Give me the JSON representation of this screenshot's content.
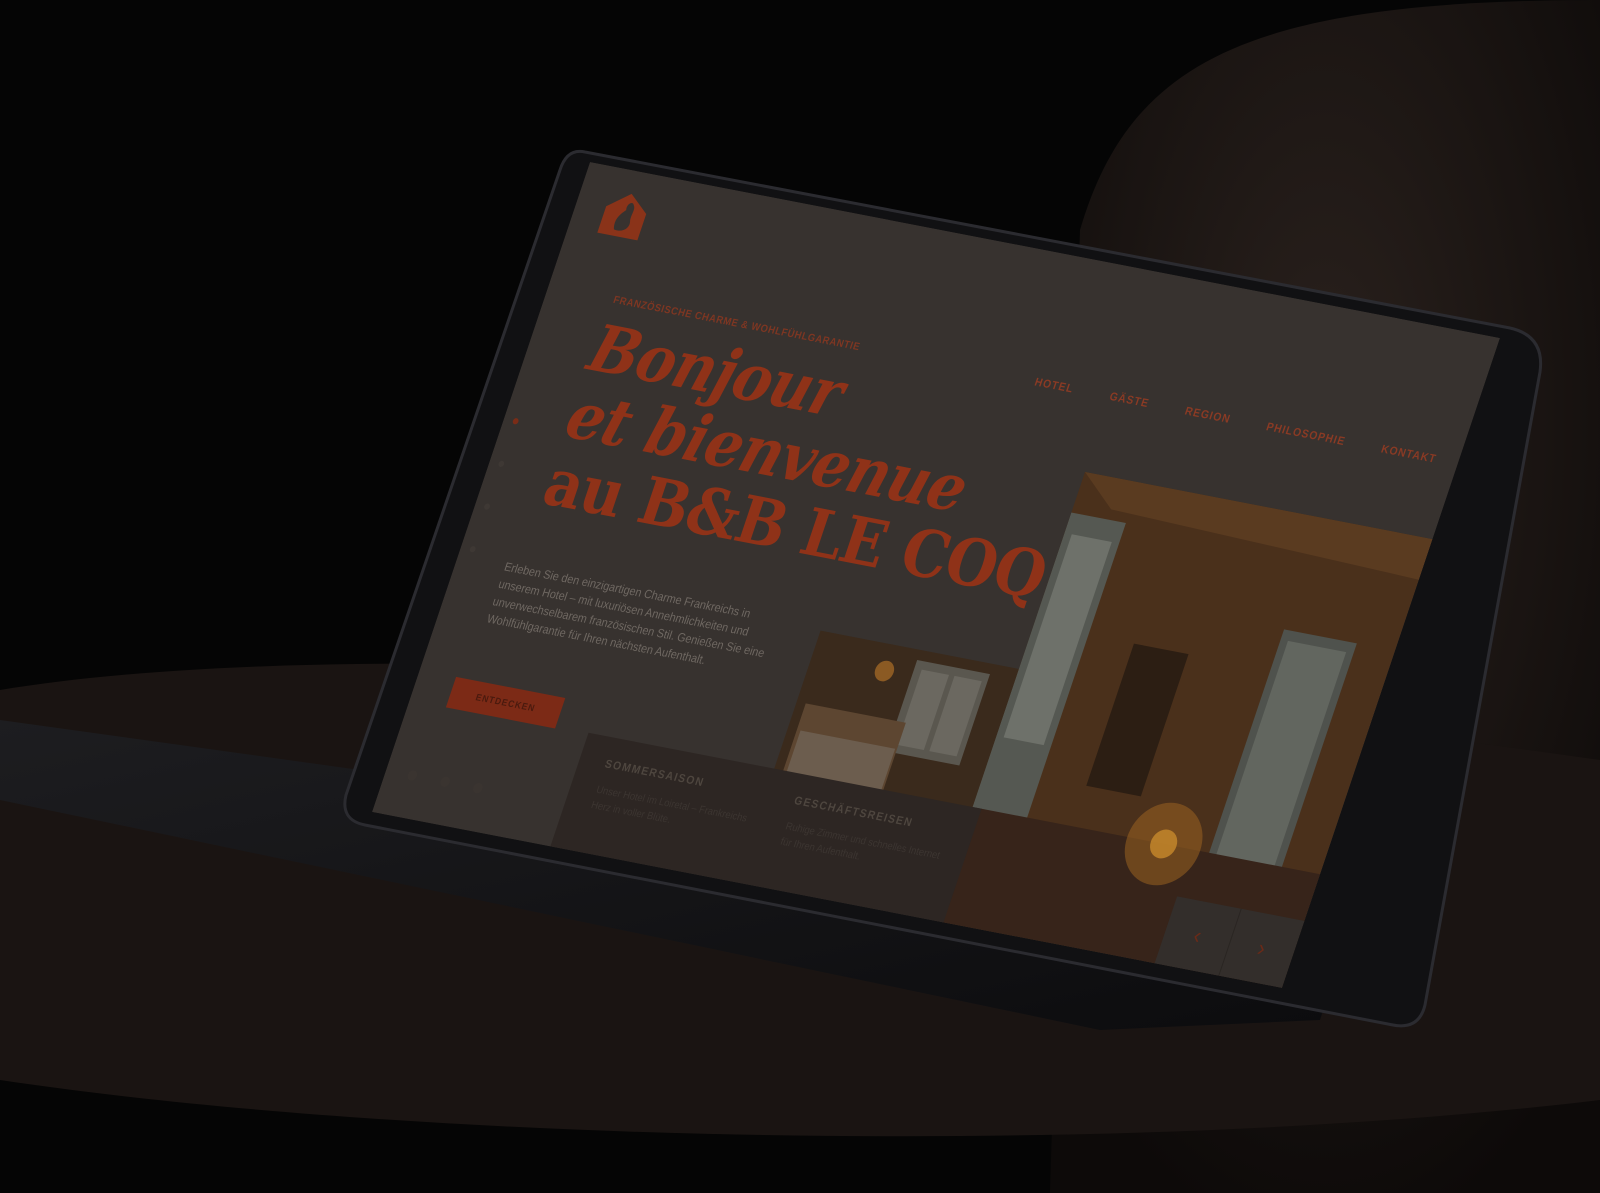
{
  "site": {
    "tagline": "FRANZÖSISCHE CHARME & WOHLFÜHLGARANTIE",
    "nav": [
      "HOTEL",
      "GÄSTE",
      "REGION",
      "PHILOSOPHIE",
      "KONTAKT"
    ],
    "headline": [
      "Bonjour",
      "et bienvenue",
      "au B&B LE COQ"
    ],
    "intro": "Erleben Sie den einzigartigen Charme Frankreichs in unserem Hotel – mit luxuriösen Annehmlichkeiten und unverwechselbarem französischen Stil. Genießen Sie eine Wohlfühlgarantie für Ihren nächsten Aufenthalt.",
    "cta_label": "ENTDECKEN",
    "seasons": [
      {
        "title": "SOMMERSAISON",
        "text": "Unser Hotel im Loiretal – Frankreichs Herz in voller Blüte."
      },
      {
        "title": "GESCHÄFTSREISEN",
        "text": "Ruhige Zimmer und schnelles Internet für Ihren Aufenthalt."
      }
    ],
    "carousel": {
      "prev": "‹",
      "next": "›"
    }
  },
  "colors": {
    "accent": "#8f3218",
    "page_bg": "#050505",
    "screen_bg": "#37322f"
  },
  "icons": [
    "rooster-house-logo-icon",
    "chevron-left-icon",
    "chevron-right-icon"
  ]
}
